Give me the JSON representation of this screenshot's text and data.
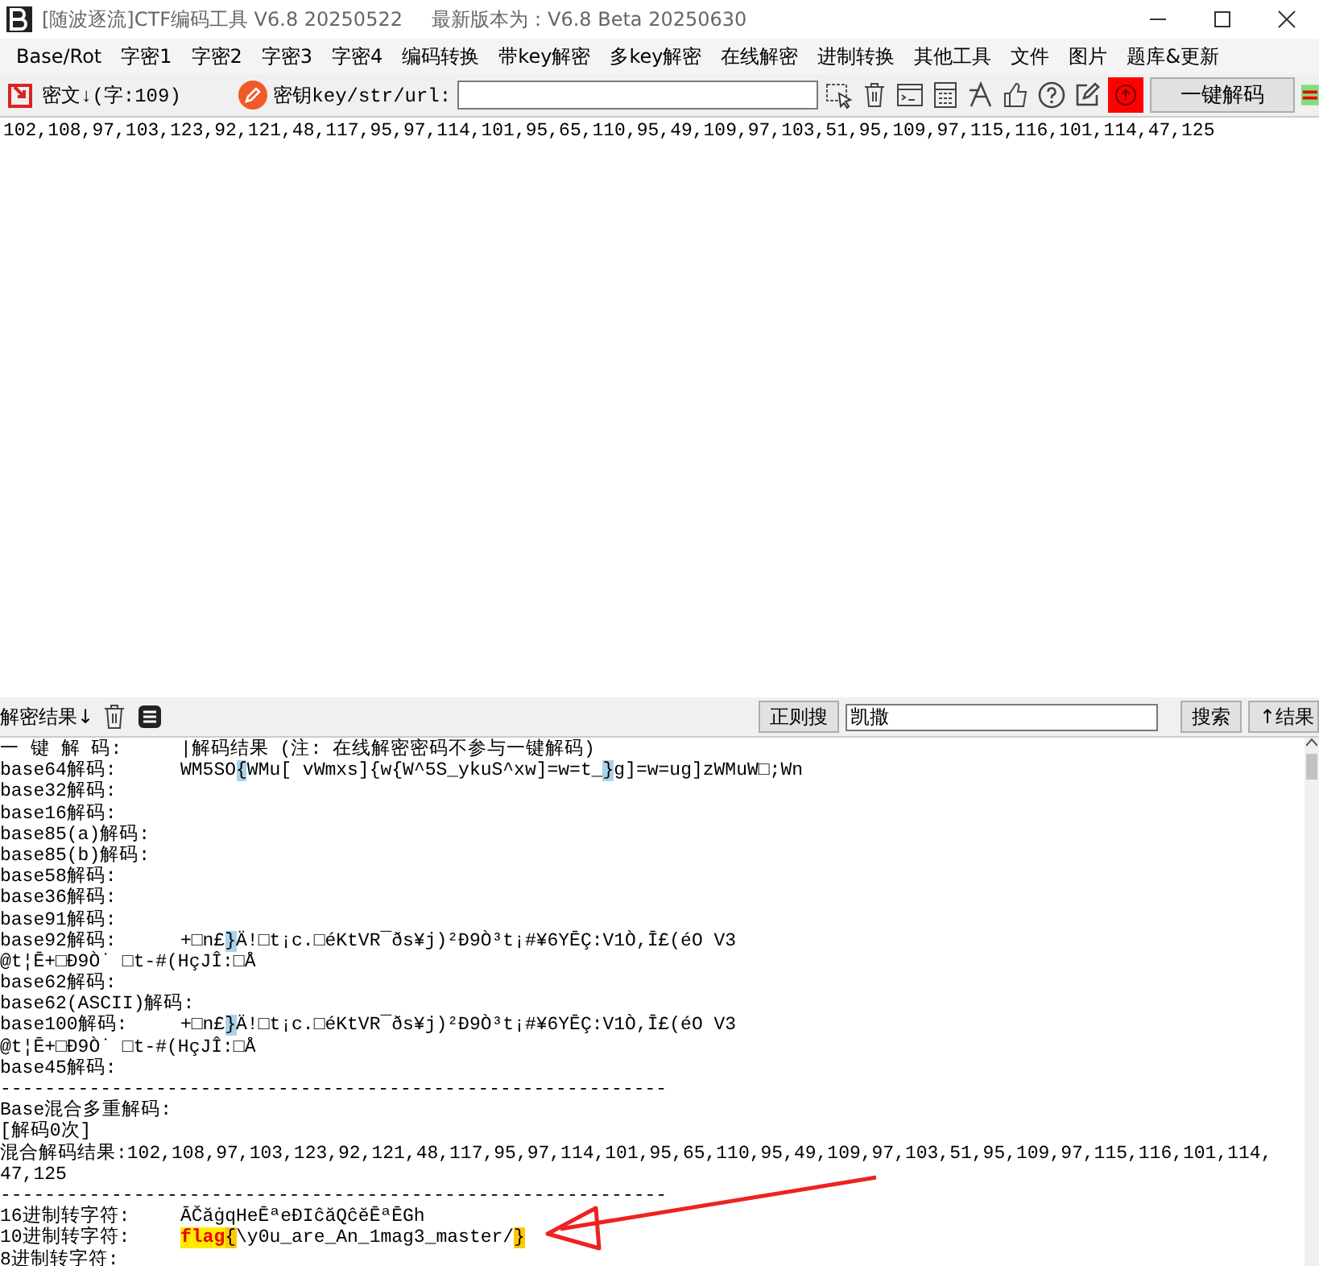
{
  "window": {
    "title": "[随波逐流]CTF编码工具 V6.8 20250522",
    "version_note": "最新版本为：V6.8 Beta 20250630"
  },
  "menu": [
    "Base/Rot",
    "字密1",
    "字密2",
    "字密3",
    "字密4",
    "编码转换",
    "带key解密",
    "多key解密",
    "在线解密",
    "进制转换",
    "其他工具",
    "文件",
    "图片",
    "题库&更新"
  ],
  "toolbar": {
    "cipher_label": "密文↓(字:109)",
    "key_label": "密钥key/str/url:",
    "decode_button": "一键解码"
  },
  "cipher_text": "102,108,97,103,123,92,121,48,117,95,97,114,101,95,65,110,95,49,109,97,103,51,95,109,97,115,116,101,114,47,125",
  "result_bar": {
    "label": "解密结果↓",
    "regex_button": "正则搜",
    "search_value": "凯撒",
    "search_button": "搜索",
    "result_button": "↑结果"
  },
  "output": [
    {
      "kind": "pair",
      "label": "一 键 解 码:",
      "segments": [
        {
          "text": "|解码结果 (注: 在线解密密码不参与一键解码)",
          "kind": "plain"
        }
      ]
    },
    {
      "kind": "pair",
      "label": "base64解码:",
      "segments": [
        {
          "text": "WM5SO",
          "kind": "plain"
        },
        {
          "text": "{",
          "kind": "match"
        },
        {
          "text": "WMu[ vWmxs]{w{W^5S_ykuS^xw]=w=t_",
          "kind": "plain"
        },
        {
          "text": "}",
          "kind": "match"
        },
        {
          "text": "g]=w=ug]zWMuW□;Wn",
          "kind": "plain"
        }
      ]
    },
    {
      "kind": "pair",
      "label": "base32解码:"
    },
    {
      "kind": "pair",
      "label": "base16解码:"
    },
    {
      "kind": "pair",
      "label": "base85(a)解码:"
    },
    {
      "kind": "pair",
      "label": "base85(b)解码:"
    },
    {
      "kind": "pair",
      "label": "base58解码:"
    },
    {
      "kind": "pair",
      "label": "base36解码:"
    },
    {
      "kind": "pair",
      "label": "base91解码:"
    },
    {
      "kind": "pair",
      "label": "base92解码:",
      "segments": [
        {
          "text": "+□n£",
          "kind": "plain"
        },
        {
          "text": "}",
          "kind": "match"
        },
        {
          "text": "Ä!□t¡c.□éKtVR¯ðs¥j)²Ð9Ò³t¡#¥6YĒÇ:V1Ò,Ī£(éO V3",
          "kind": "plain"
        }
      ]
    },
    {
      "kind": "text",
      "segments": [
        {
          "text": "@t¦Ē+□Ð9Ò˙ □t-#(HçJÎ:□Å",
          "kind": "plain"
        }
      ]
    },
    {
      "kind": "pair",
      "label": "base62解码:"
    },
    {
      "kind": "pair",
      "label": "base62(ASCII)解码:"
    },
    {
      "kind": "pair",
      "label": "base100解码:",
      "segments": [
        {
          "text": "+□n£",
          "kind": "plain"
        },
        {
          "text": "}",
          "kind": "match"
        },
        {
          "text": "Ä!□t¡c.□éKtVR¯ðs¥j)²Ð9Ò³t¡#¥6YĒÇ:V1Ò,Ī£(éO V3",
          "kind": "plain"
        }
      ]
    },
    {
      "kind": "text",
      "segments": [
        {
          "text": "@t¦Ē+□Ð9Ò˙ □t-#(HçJÎ:□Å",
          "kind": "plain"
        }
      ]
    },
    {
      "kind": "pair",
      "label": "base45解码:"
    },
    {
      "kind": "text",
      "segments": [
        {
          "text": "------------------------------------------------------------",
          "kind": "plain"
        }
      ]
    },
    {
      "kind": "text",
      "segments": [
        {
          "text": "Base混合多重解码:",
          "kind": "plain"
        }
      ]
    },
    {
      "kind": "text",
      "segments": [
        {
          "text": "[解码0次]",
          "kind": "plain"
        }
      ]
    },
    {
      "kind": "text",
      "segments": [
        {
          "text": "混合解码结果:102,108,97,103,123,92,121,48,117,95,97,114,101,95,65,110,95,49,109,97,103,51,95,109,97,115,116,101,114,",
          "kind": "plain"
        }
      ]
    },
    {
      "kind": "text",
      "segments": [
        {
          "text": "47,125",
          "kind": "plain"
        }
      ]
    },
    {
      "kind": "text",
      "segments": [
        {
          "text": "------------------------------------------------------------",
          "kind": "plain"
        }
      ]
    },
    {
      "kind": "pair",
      "label": "16进制转字符:",
      "segments": [
        {
          "text": "ĀČăġqHeĒªeÐIĉăQĉĕĒªĒGh",
          "kind": "plain"
        }
      ]
    },
    {
      "kind": "pair",
      "label": "10进制转字符:",
      "segments": [
        {
          "text": "flag",
          "kind": "flag"
        },
        {
          "text": "{",
          "kind": "mark"
        },
        {
          "text": "\\y0u_are_An_1mag3_master/",
          "kind": "plain"
        },
        {
          "text": "}",
          "kind": "mark"
        }
      ]
    },
    {
      "kind": "pair",
      "label": "8进制转字符:"
    }
  ]
}
